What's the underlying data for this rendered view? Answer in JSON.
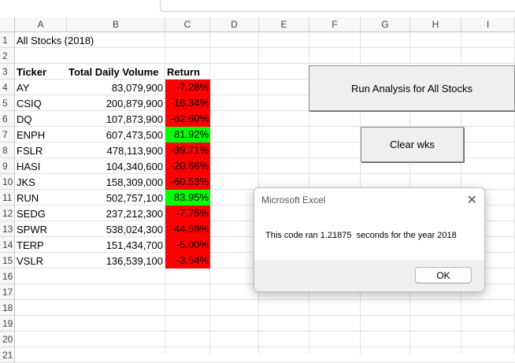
{
  "columns": [
    "A",
    "B",
    "C",
    "D",
    "E",
    "F",
    "G",
    "H",
    "I"
  ],
  "rows": [
    "1",
    "2",
    "3",
    "4",
    "5",
    "6",
    "7",
    "8",
    "9",
    "10",
    "11",
    "12",
    "13",
    "14",
    "15",
    "16",
    "17",
    "18",
    "19",
    "20",
    "21"
  ],
  "sheet": {
    "title": "All Stocks (2018)",
    "headers": {
      "ticker": "Ticker",
      "volume": "Total Daily Volume",
      "return": "Return"
    },
    "data": [
      {
        "ticker": "AY",
        "volume": "83,079,900",
        "return": "-7.28%",
        "status": "negative"
      },
      {
        "ticker": "CSIQ",
        "volume": "200,879,900",
        "return": "-16.34%",
        "status": "negative"
      },
      {
        "ticker": "DQ",
        "volume": "107,873,900",
        "return": "-62.60%",
        "status": "negative"
      },
      {
        "ticker": "ENPH",
        "volume": "607,473,500",
        "return": "81.92%",
        "status": "positive"
      },
      {
        "ticker": "FSLR",
        "volume": "478,113,900",
        "return": "-39.71%",
        "status": "negative"
      },
      {
        "ticker": "HASI",
        "volume": "104,340,600",
        "return": "-20.66%",
        "status": "negative"
      },
      {
        "ticker": "JKS",
        "volume": "158,309,000",
        "return": "-60.53%",
        "status": "negative"
      },
      {
        "ticker": "RUN",
        "volume": "502,757,100",
        "return": "83.95%",
        "status": "positive"
      },
      {
        "ticker": "SEDG",
        "volume": "237,212,300",
        "return": "-7.75%",
        "status": "negative"
      },
      {
        "ticker": "SPWR",
        "volume": "538,024,300",
        "return": "-44.59%",
        "status": "negative"
      },
      {
        "ticker": "TERP",
        "volume": "151,434,700",
        "return": "-5.00%",
        "status": "negative"
      },
      {
        "ticker": "VSLR",
        "volume": "136,539,100",
        "return": "-3.54%",
        "status": "negative"
      }
    ]
  },
  "buttons": {
    "run_analysis": "Run Analysis for All Stocks",
    "clear": "Clear wks"
  },
  "dialog": {
    "title": "Microsoft Excel",
    "message": "This code ran 1.21875  seconds for the year 2018",
    "ok": "OK",
    "close_icon": "close-icon"
  },
  "colors": {
    "negative": "#ff0000",
    "positive": "#00ff00"
  }
}
